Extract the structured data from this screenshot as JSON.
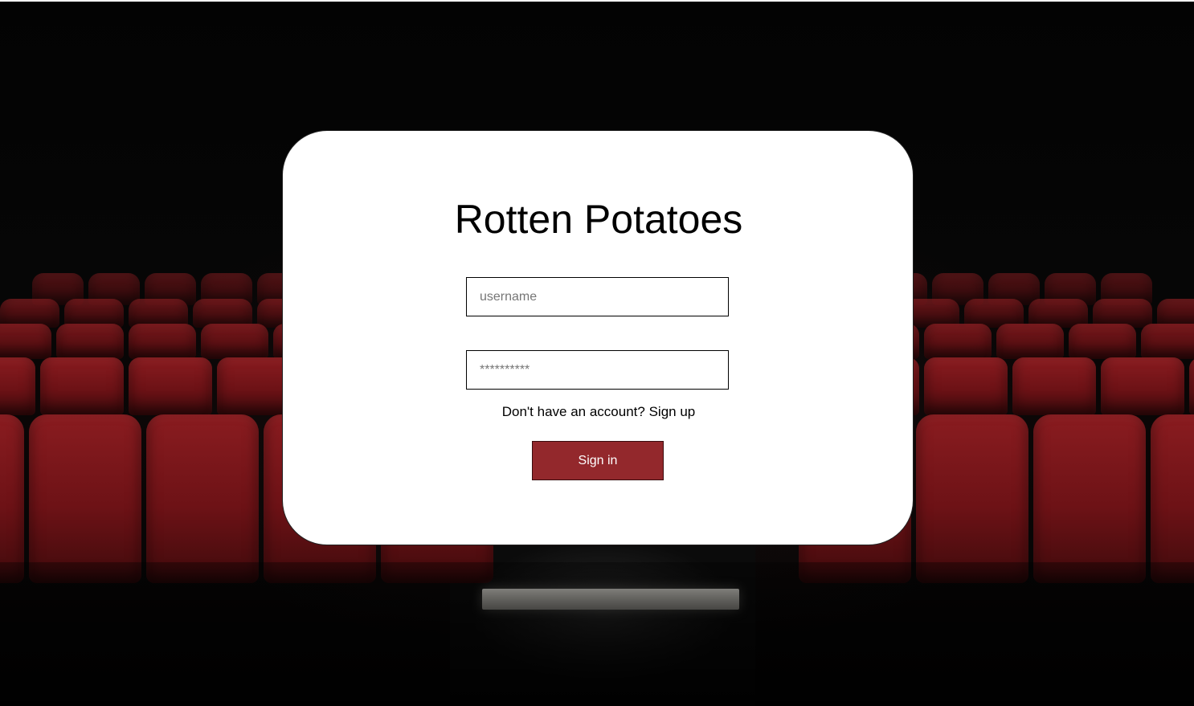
{
  "app": {
    "title": "Rotten Potatoes"
  },
  "login": {
    "username_placeholder": "username",
    "username_value": "",
    "password_placeholder": "**********",
    "password_value": "",
    "signup_prompt": "Don't have an account?",
    "signup_link": "Sign up",
    "signin_label": "Sign in"
  },
  "background": {
    "description_icon": "theater-seats-background"
  },
  "colors": {
    "accent": "#93282c",
    "card": "#ffffff",
    "seat": "#7a161a"
  }
}
